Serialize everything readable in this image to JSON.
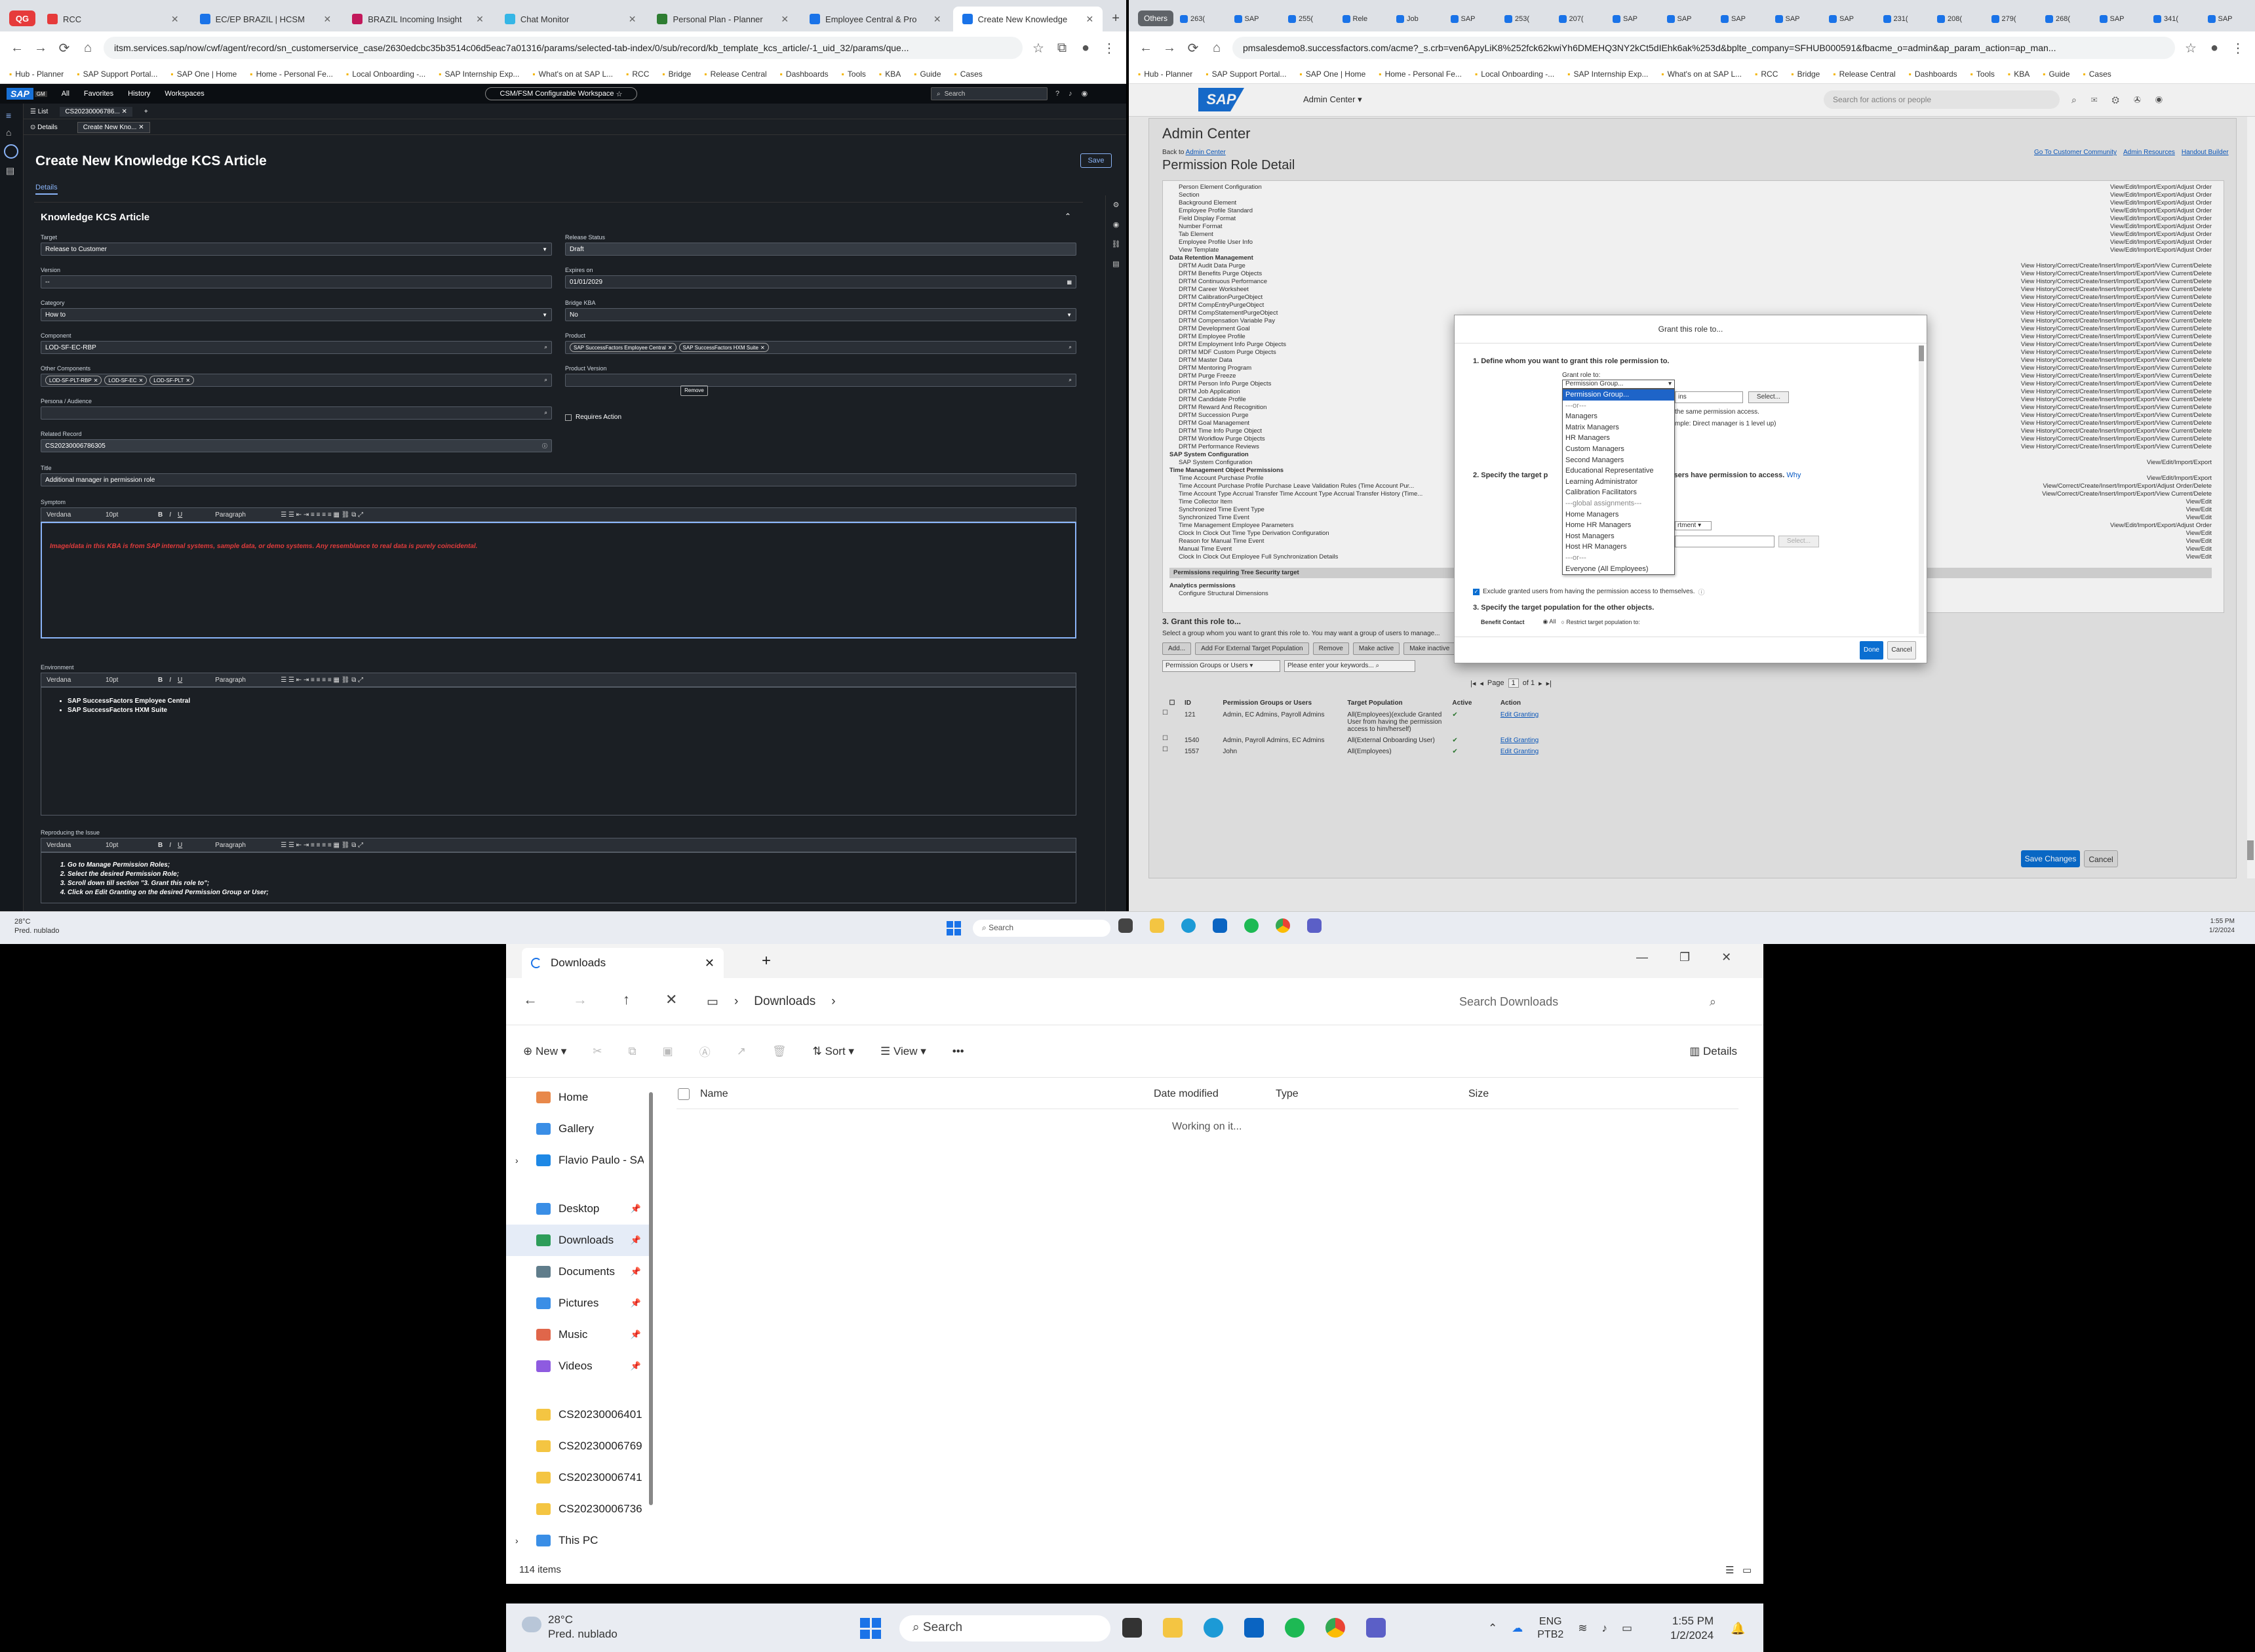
{
  "left_browser": {
    "tabs": [
      {
        "label": "RCC",
        "color": "#e63b3b",
        "active": false
      },
      {
        "label": "EC/EP BRAZIL | HCSM",
        "color": "#1a73e8",
        "active": false
      },
      {
        "label": "BRAZIL Incoming Insight",
        "color": "#c2185b",
        "active": false
      },
      {
        "label": "Chat Monitor",
        "color": "#35b6e6",
        "active": false
      },
      {
        "label": "Personal Plan - Planner",
        "color": "#2e7d32",
        "active": false
      },
      {
        "label": "Employee Central & Pro",
        "color": "#1a73e8",
        "active": false
      },
      {
        "label": "Create New Knowledge",
        "color": "#1a73e8",
        "active": true
      }
    ],
    "url": "itsm.services.sap/now/cwf/agent/record/sn_customerservice_case/2630edcbc35b3514c06d5eac7a01316/params/selected-tab-index/0/sub/record/kb_template_kcs_article/-1_uid_32/params/que...",
    "bookmarks": [
      "Hub - Planner",
      "SAP Support Portal...",
      "SAP One | Home",
      "Home - Personal Fe...",
      "Local Onboarding -...",
      "SAP Internship Exp...",
      "What's on at SAP L...",
      "RCC",
      "Bridge",
      "Release Central",
      "Dashboards",
      "Tools",
      "KBA",
      "Guide",
      "Cases"
    ]
  },
  "sap_app": {
    "topbar": {
      "menu": [
        "All",
        "Favorites",
        "History",
        "Workspaces"
      ],
      "workspace": "CSM/FSM Configurable Workspace",
      "search_placeholder": "Search",
      "logo": "SAP",
      "logo_badge": "GM"
    },
    "subtabs": {
      "list": "List",
      "record": "CS20230006786..."
    },
    "innertabs": {
      "details": "Details",
      "create": "Create New Kno..."
    },
    "page_title": "Create New Knowledge KCS Article",
    "save": "Save",
    "details_tab": "Details",
    "section_title": "Knowledge KCS Article",
    "fields": {
      "target_label": "Target",
      "target_value": "Release to Customer",
      "version_label": "Version",
      "version_value": "--",
      "category_label": "Category",
      "category_value": "How to",
      "component_label": "Component",
      "component_value": "LOD-SF-EC-RBP",
      "other_components_label": "Other Components",
      "other_components": [
        "LOD-SF-PLT-RBP",
        "LOD-SF-EC",
        "LOD-SF-PLT"
      ],
      "persona_label": "Persona / Audience",
      "related_label": "Related Record",
      "related_value": "CS20230006786305",
      "title_label": "Title",
      "title_value": "Additional manager in permission role",
      "release_label": "Release Status",
      "release_value": "Draft",
      "expires_label": "Expires on",
      "expires_value": "01/01/2029",
      "bridge_label": "Bridge KBA",
      "bridge_value": "No",
      "product_label": "Product",
      "products": [
        "SAP SuccessFactors Employee Central",
        "SAP SuccessFactors HXM Suite"
      ],
      "product_version_label": "Product Version",
      "remove": "Remove",
      "requires_action": "Requires Action"
    },
    "toolbar": {
      "font": "Verdana",
      "size": "10pt",
      "format": "Paragraph"
    },
    "symptom_label": "Symptom",
    "symptom_text": "Image/data in this KBA is from SAP internal systems, sample data, or demo systems. Any resemblance to real data is purely coincidental.",
    "environment_label": "Environment",
    "environment_items": [
      "SAP SuccessFactors Employee Central",
      "SAP SuccessFactors HXM Suite"
    ],
    "reproducing_label": "Reproducing the Issue",
    "reproducing_items": [
      "Go to Manage Permission Roles;",
      "Select the desired Permission Role;",
      "Scroll down till section \"3. Grant this role to\";",
      "Click on Edit Granting on the desired Permission Group or User;"
    ]
  },
  "right_browser": {
    "group_label": "Others",
    "tabs": [
      "263(",
      "SAP",
      "255(",
      "Rele",
      "Job",
      "SAP",
      "253(",
      "207(",
      "SAP",
      "SAP",
      "SAP",
      "SAP",
      "SAP",
      "231(",
      "208(",
      "279(",
      "268(",
      "SAP",
      "341(",
      "SAP"
    ],
    "url": "pmsalesdemo8.successfactors.com/acme?_s.crb=ven6ApyLiK8%252fck62kwiYh6DMEHQ3NY2kCt5dIEhk6ak%253d&bplte_company=SFHUB000591&fbacme_o=admin&ap_param_action=ap_man...",
    "bookmarks": [
      "Hub - Planner",
      "SAP Support Portal...",
      "SAP One | Home",
      "Home - Personal Fe...",
      "Local Onboarding -...",
      "SAP Internship Exp...",
      "What's on at SAP L...",
      "RCC",
      "Bridge",
      "Release Central",
      "Dashboards",
      "Tools",
      "KBA",
      "Guide",
      "Cases"
    ]
  },
  "sf": {
    "admin_center": "Admin Center",
    "search_placeholder": "Search for actions or people",
    "heading": "Admin Center",
    "back_prefix": "Back to",
    "back_link": "Admin Center",
    "links": [
      "Go To Customer Community",
      "Admin Resources",
      "Handout Builder"
    ],
    "page_title": "Permission Role Detail",
    "perm_list": [
      "Person Element Configuration",
      "Section",
      "Background Element",
      "Employee Profile Standard",
      "Field Display Format",
      "Number Format",
      "Tab Element",
      "Employee Profile User Info",
      "View Template"
    ],
    "perm_list_values": [
      "View/Edit/Import/Export/Adjust Order",
      "View/Edit/Import/Export/Adjust Order",
      "View/Edit/Import/Export/Adjust Order",
      "View/Edit/Import/Export/Adjust Order",
      "View/Edit/Import/Export/Adjust Order",
      "View/Edit/Import/Export/Adjust Order",
      "View/Edit/Import/Export/Adjust Order",
      "View/Edit/Import/Export/Adjust Order",
      "View/Edit/Import/Export/Adjust Order"
    ],
    "drm_heading": "Data Retention Management",
    "drm_list": [
      "DRTM Audit Data Purge",
      "DRTM Benefits Purge Objects",
      "DRTM Continuous Performance",
      "DRTM Career Worksheet",
      "DRTM CalibrationPurgeObject",
      "DRTM CompEntryPurgeObject",
      "DRTM CompStatementPurgeObject",
      "DRTM Compensation Variable Pay",
      "DRTM Development Goal",
      "DRTM Employee Profile",
      "DRTM Employment Info Purge Objects",
      "DRTM MDF Custom Purge Objects",
      "DRTM Master Data",
      "DRTM Mentoring Program",
      "DRTM Purge Freeze",
      "DRTM Person Info Purge Objects",
      "DRTM Job Application",
      "DRTM Candidate Profile",
      "DRTM Reward And Recognition",
      "DRTM Succession Purge",
      "DRTM Goal Management",
      "DRTM Time Info Purge Object",
      "DRTM Workflow Purge Objects",
      "DRTM Performance Reviews"
    ],
    "drm_value": "View History/Correct/Create/Insert/Import/Export/View Current/Delete",
    "sys_heading": "SAP System Configuration",
    "sys_list": [
      "SAP System Configuration"
    ],
    "sys_value": "View/Edit/Import/Export",
    "tm_heading": "Time Management Object Permissions",
    "tm_list": [
      "Time Account Purchase Profile",
      "Time Account Purchase Profile Purchase Leave Validation Rules (Time Account Pur...",
      "Time Account Type Accrual Transfer Time Account Type Accrual Transfer History (Time...",
      "Time Collector Item",
      "Synchronized Time Event Type",
      "Synchronized Time Event",
      "Time Management Employee Parameters",
      "Clock In Clock Out Time Type Derivation Configuration",
      "Reason for Manual Time Event",
      "Manual Time Event",
      "Clock In Clock Out Employee Full Synchronization Details"
    ],
    "tm_values": [
      "View/Edit/Import/Export",
      "View/Correct/Create/Insert/Import/Export/Adjust Order/Delete",
      "View/Correct/Create/Insert/Import/Export/View Current/Delete",
      "View/Edit",
      "View/Edit",
      "View/Edit",
      "View/Edit/Import/Export/Adjust Order",
      "View/Edit",
      "View/Edit",
      "View/Edit",
      "View/Edit"
    ],
    "tree_bar": "Permissions requiring Tree Security target",
    "analytics_heading": "Analytics permissions",
    "analytics_item": "Configure Structural Dimensions",
    "grant_heading": "3. Grant this role to...",
    "grant_desc": "Select a group whom you want to grant this role to. You may want a group of users to manage...",
    "buttons": [
      "Add...",
      "Add For External Target Population",
      "Remove",
      "Make active",
      "Make inactive"
    ],
    "filter_select": "Permission Groups or Users",
    "filter_placeholder": "Please enter your keywords...",
    "pager": {
      "label": "Page",
      "page": "1",
      "of": "of 1"
    },
    "table_headers": [
      "ID",
      "Permission Groups or Users",
      "Target Population",
      "Active",
      "Action"
    ],
    "rows": [
      {
        "id": "121",
        "groups": "Admin, EC Admins, Payroll Admins",
        "target": "All(Employees)(exclude Granted User from having the permission access to him/herself)",
        "action": "Edit Granting"
      },
      {
        "id": "1540",
        "groups": "Admin, Payroll Admins, EC Admins",
        "target": "All(External Onboarding User)",
        "action": "Edit Granting"
      },
      {
        "id": "1557",
        "groups": "John",
        "target": "All(Employees)",
        "action": "Edit Granting"
      }
    ],
    "save_changes": "Save Changes",
    "cancel": "Cancel"
  },
  "modal": {
    "title": "Grant this role to...",
    "step1": "1. Define whom you want to grant this role permission to.",
    "grant_role_to": "Grant role to:",
    "select_value": "Permission Group...",
    "side_input": "ins",
    "select_btn": "Select...",
    "same_access": "the same permission access.",
    "example": "mple: Direct manager is 1 level up)",
    "step2": "2. Specify the target p",
    "step2_rest": "anted users have permission to access.",
    "why": "Why",
    "dept_select": "rtment",
    "select_btn2": "Select...",
    "exclude": "Exclude granted users from having the permission access to themselves.",
    "step3": "3. Specify the target population for the other objects.",
    "benefit_contact": "Benefit Contact",
    "all_label": "All",
    "restrict": "Restrict target population to:",
    "done": "Done",
    "cancel": "Cancel",
    "options": [
      "Permission Group...",
      "---or---",
      "Managers",
      "Matrix Managers",
      "HR Managers",
      "Custom Managers",
      "Second Managers",
      "Educational Representative",
      "Learning Administrator",
      "Calibration Facilitators",
      "---global assignments---",
      "Home Managers",
      "Home HR Managers",
      "Host Managers",
      "Host HR Managers",
      "---or---",
      "Everyone (All Employees)"
    ]
  },
  "mini_taskbar": {
    "weather_temp": "28°C",
    "weather_desc": "Pred. nublado",
    "search": "Search",
    "time": "1:55 PM",
    "date": "1/2/2024"
  },
  "explorer": {
    "tab_title": "Downloads",
    "breadcrumb": "Downloads",
    "search_placeholder": "Search Downloads",
    "toolbar": {
      "new": "New",
      "sort": "Sort",
      "view": "View",
      "details": "Details"
    },
    "nav": [
      {
        "label": "Home",
        "color": "#e8884a",
        "pinned": false
      },
      {
        "label": "Gallery",
        "color": "#3a8ee6",
        "pinned": false
      },
      {
        "label": "Flavio Paulo - SA",
        "color": "#1e88e5",
        "pinned": false
      },
      {
        "label": "Desktop",
        "color": "#3a8ee6",
        "pinned": true
      },
      {
        "label": "Downloads",
        "color": "#2e9d5a",
        "pinned": true
      },
      {
        "label": "Documents",
        "color": "#607d8b",
        "pinned": true
      },
      {
        "label": "Pictures",
        "color": "#3a8ee6",
        "pinned": true
      },
      {
        "label": "Music",
        "color": "#e0664a",
        "pinned": true
      },
      {
        "label": "Videos",
        "color": "#8e5be0",
        "pinned": true
      },
      {
        "label": "CS20230006401",
        "color": "#f4c542",
        "pinned": false
      },
      {
        "label": "CS20230006769",
        "color": "#f4c542",
        "pinned": false
      },
      {
        "label": "CS20230006741",
        "color": "#f4c542",
        "pinned": false
      },
      {
        "label": "CS20230006736",
        "color": "#f4c542",
        "pinned": false
      },
      {
        "label": "This PC",
        "color": "#3a8ee6",
        "pinned": false
      }
    ],
    "columns": [
      "Name",
      "Date modified",
      "Type",
      "Size"
    ],
    "working": "Working on it...",
    "status": "114 items"
  },
  "taskbar": {
    "weather_temp": "28°C",
    "weather_desc": "Pred. nublado",
    "search": "Search",
    "lang1": "ENG",
    "lang2": "PTB2",
    "time": "1:55 PM",
    "date": "1/2/2024"
  }
}
